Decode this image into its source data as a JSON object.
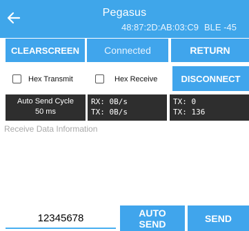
{
  "header": {
    "title": "Pegasus",
    "mac_address": "48:87:2D:AB:03:C9",
    "ble_signal": "BLE -45"
  },
  "buttons": {
    "clear_screen": "CLEARSCREEN",
    "status": "Connected",
    "return": "RETURN",
    "disconnect": "DISCONNECT",
    "auto_send": "AUTO SEND",
    "send": "SEND"
  },
  "options": {
    "hex_transmit": "Hex Transmit",
    "hex_receive": "Hex Receive"
  },
  "stats": {
    "auto_send_cycle_label": "Auto Send Cycle",
    "auto_send_cycle_value": "50 ms",
    "rx_rate": "RX: 0B/s",
    "tx_rate": "TX: 0B/s",
    "tx_count": "TX: 0",
    "rx_count": "TX: 136"
  },
  "receive_area": {
    "placeholder": "Receive Data Information"
  },
  "send_input": {
    "value": "12345678"
  },
  "colors": {
    "accent": "#40a5ec",
    "header": "#3fa6ea",
    "stat_bg": "#2e2e2e"
  }
}
